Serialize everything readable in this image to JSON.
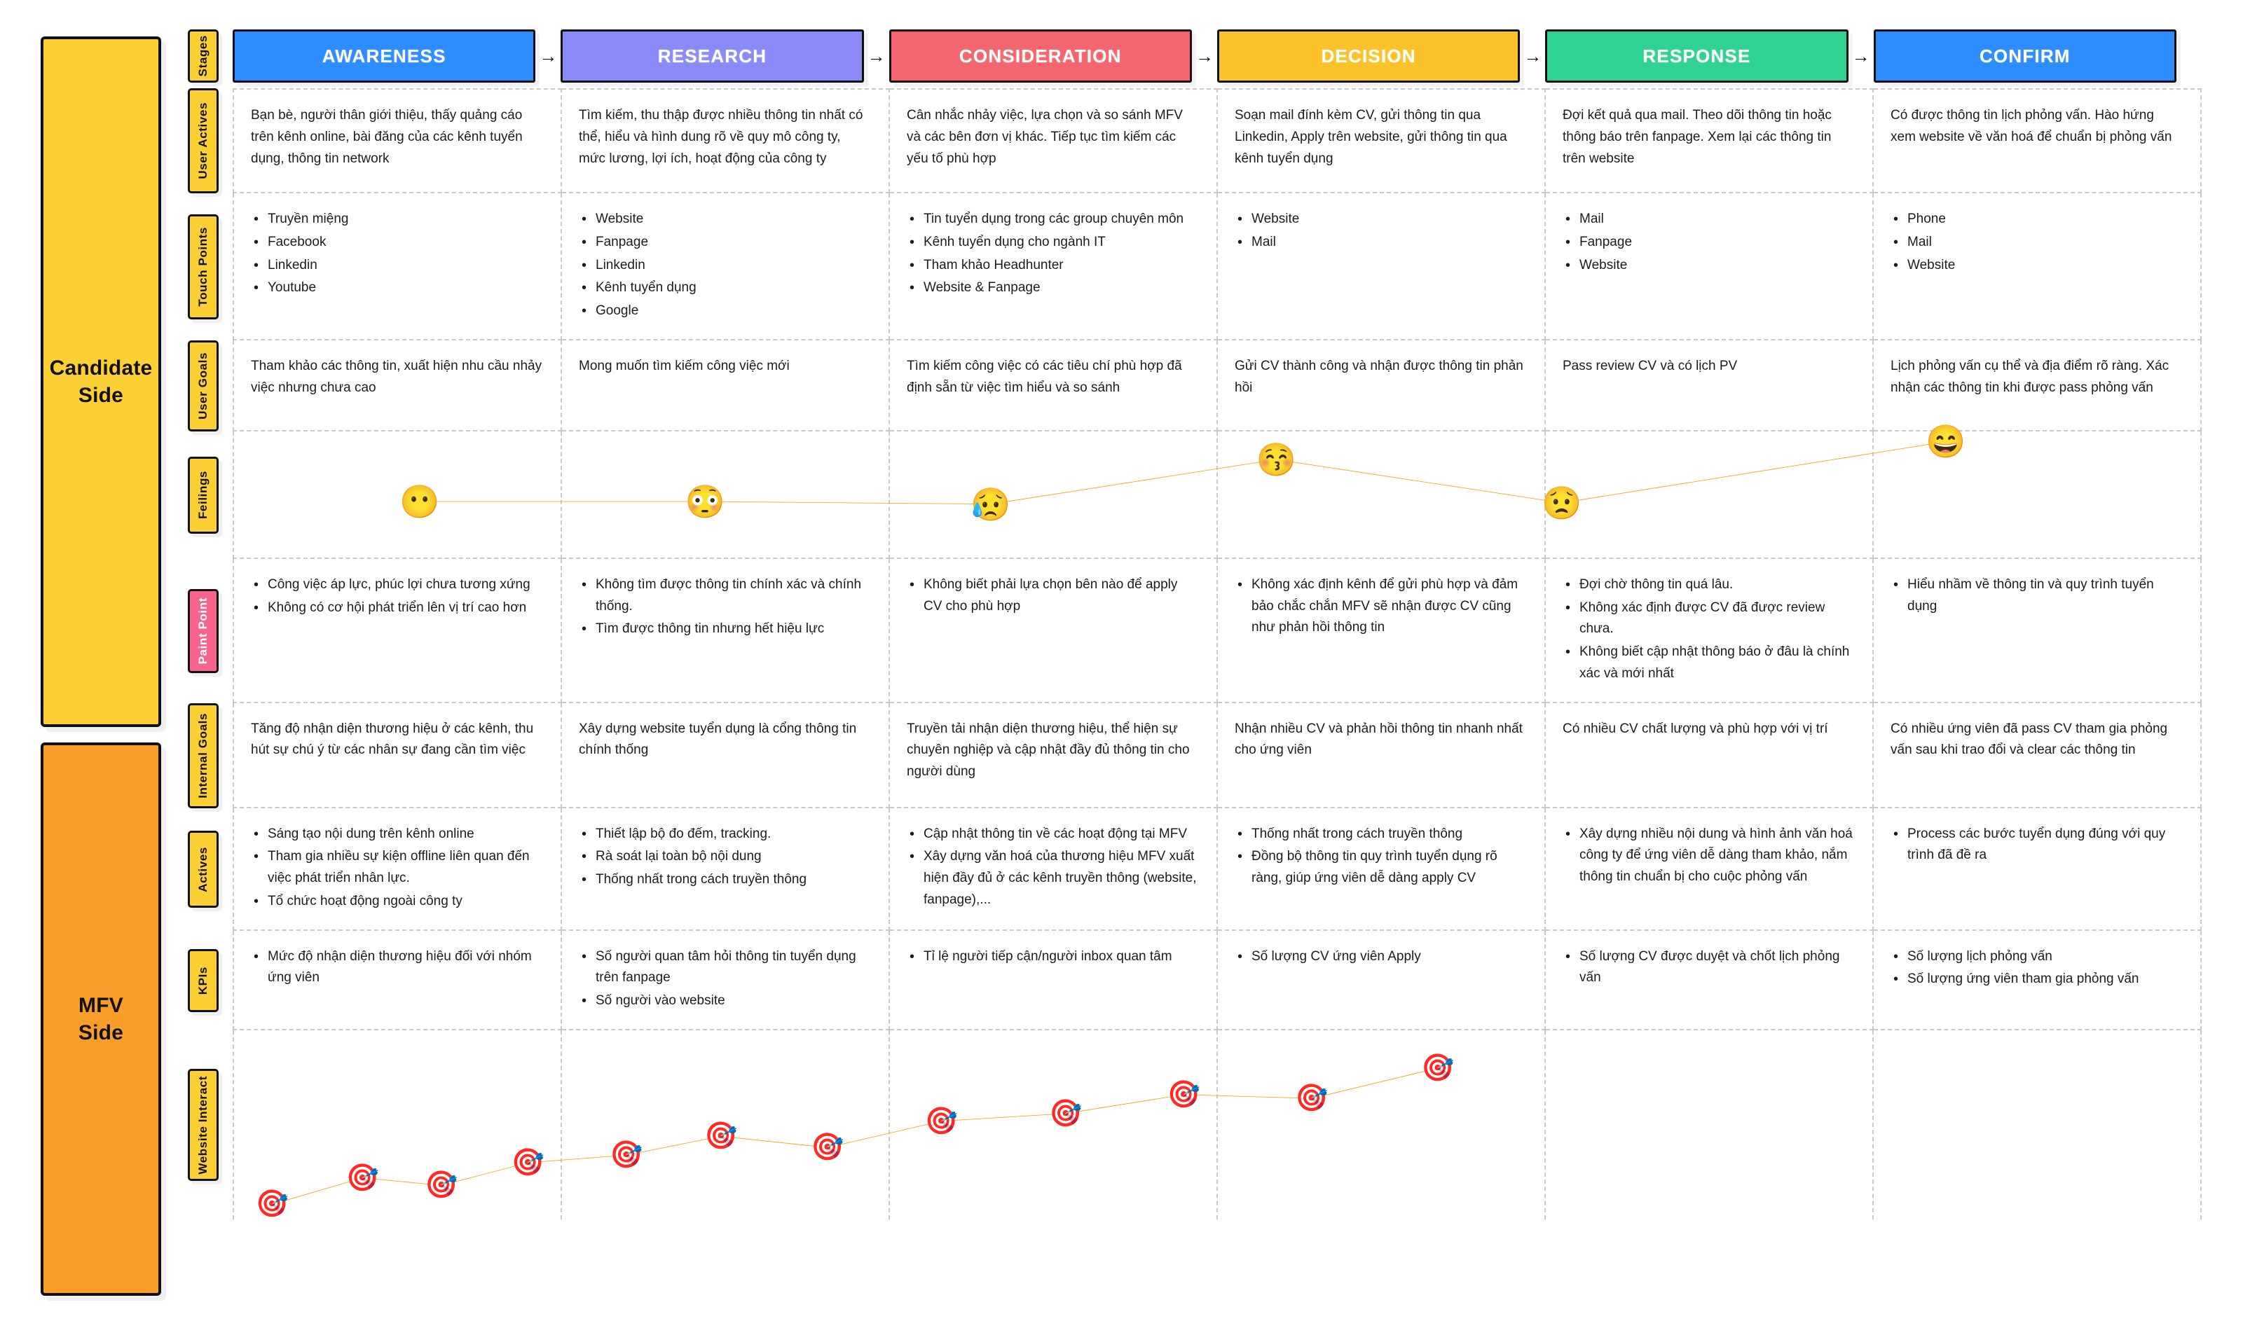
{
  "sides": [
    {
      "name": "candidate",
      "label": "Candidate\nSide",
      "color": "#fcd034"
    },
    {
      "name": "mfv",
      "label": "MFV\nSide",
      "color": "#f89c2a"
    }
  ],
  "row_labels": {
    "stages": "Stages",
    "user_actives": "User Actives",
    "touch_points": "Touch Points",
    "user_goals": "User Goals",
    "feelings": "Feilings",
    "pain_point": "Paint Point",
    "internal_goals": "Internal Goals",
    "actives": "Actives",
    "kpis": "KPIs",
    "website_interact": "Website Interact"
  },
  "arrow_glyph": "→",
  "stages": [
    {
      "label": "AWARENESS",
      "color": "#2d8cff"
    },
    {
      "label": "RESEARCH",
      "color": "#8b8bf7"
    },
    {
      "label": "CONSIDERATION",
      "color": "#f4666e"
    },
    {
      "label": "DECISION",
      "color": "#fcc22b"
    },
    {
      "label": "RESPONSE",
      "color": "#2fd291"
    },
    {
      "label": "CONFIRM",
      "color": "#2d8cff"
    }
  ],
  "user_actives": [
    "Bạn bè, người thân giới thiệu, thấy quảng cáo trên kênh online, bài đăng của các kênh tuyển dụng, thông tin network",
    "Tìm kiếm, thu thập được nhiều thông tin nhất có thể, hiểu và hình dung rõ về quy mô công ty, mức lương, lợi ích, hoạt động của công ty",
    "Cân nhắc nhảy việc, lựa chọn và so sánh MFV và các bên đơn vị khác. Tiếp tục tìm kiếm các yếu tố phù hợp",
    "Soạn mail đính kèm CV, gửi thông tin qua Linkedin, Apply trên website, gửi thông tin qua kênh tuyển dụng",
    "Đợi kết quả qua mail. Theo dõi thông tin hoặc thông báo trên fanpage. Xem lại các thông tin trên website",
    "Có được thông tin lịch phỏng vấn. Hào hứng xem website về văn hoá để chuẩn bị phỏng vấn"
  ],
  "touch_points": [
    [
      "Truyền miệng",
      "Facebook",
      "Linkedin",
      "Youtube"
    ],
    [
      "Website",
      "Fanpage",
      "Linkedin",
      "Kênh tuyển dụng",
      "Google"
    ],
    [
      "Tin tuyển dụng trong các group chuyên môn",
      "Kênh tuyển dụng cho ngành IT",
      "Tham khảo Headhunter",
      "Website & Fanpage"
    ],
    [
      "Website",
      "Mail"
    ],
    [
      "Mail",
      "Fanpage",
      "Website"
    ],
    [
      "Phone",
      "Mail",
      "Website"
    ]
  ],
  "user_goals": [
    "Tham khảo các thông tin, xuất hiện nhu cầu nhảy việc nhưng chưa cao",
    "Mong muốn tìm kiếm công việc mới",
    "Tìm kiếm công việc có các tiêu chí phù hợp đã định sẵn từ việc tìm hiểu và so sánh",
    "Gửi CV thành công và nhận được thông tin phản hồi",
    "Pass review CV và có lịch PV",
    "Lịch phỏng vấn cụ thể và địa điểm rõ ràng. Xác nhận các thông tin khi được pass phỏng vấn"
  ],
  "pain_point": [
    [
      "Công việc áp lực, phúc lợi chưa tương xứng",
      "Không có cơ hội phát triển lên vị trí cao hơn"
    ],
    [
      "Không tìm được thông tin chính xác và chính thống.",
      "Tìm được thông tin nhưng hết hiệu lực"
    ],
    [
      "Không biết phải lựa chọn bên nào để apply CV cho phù hợp"
    ],
    [
      "Không xác định kênh để gửi phù hợp và đảm bảo chắc chắn MFV sẽ nhận được CV cũng như phản hồi thông tin"
    ],
    [
      "Đợi chờ thông tin quá lâu.",
      "Không xác định được CV đã được review chưa.",
      "Không biết cập nhật thông báo ở đâu là chính xác và mới nhất"
    ],
    [
      "Hiểu nhầm về thông tin và quy trình tuyển dụng"
    ]
  ],
  "internal_goals": [
    "Tăng độ nhận diện thương hiệu ở các kênh, thu hút sự chú ý từ các nhân sự đang cần tìm việc",
    "Xây dựng website tuyển dụng là cổng thông tin chính thống",
    "Truyền tải nhận diện thương hiệu, thể hiện sự chuyên nghiệp và cập nhật đầy đủ thông tin cho người dùng",
    "Nhận nhiều CV và phản hồi thông tin nhanh nhất cho ứng viên",
    "Có nhiều CV chất lượng và phù hợp với vị trí",
    "Có nhiều ứng viên đã pass CV tham gia phỏng vấn sau khi trao đổi và clear các thông tin"
  ],
  "actives": [
    [
      "Sáng tạo nội dung trên kênh online",
      "Tham gia nhiều sự kiện offline liên quan đến việc phát triển nhân lực.",
      "Tổ chức hoạt động ngoài công ty"
    ],
    [
      "Thiết lập bộ đo đếm, tracking.",
      "Rà soát lại toàn bộ nội dung",
      "Thống nhất trong cách truyền thông"
    ],
    [
      "Cập nhật thông tin về các  hoạt động tại MFV",
      "Xây dựng văn hoá của thương hiệu MFV xuất hiện đầy đủ ở các kênh truyền thông (website, fanpage),..."
    ],
    [
      "Thống nhất trong cách truyền thông",
      "Đồng bộ thông tin quy trình tuyển dụng rõ ràng, giúp ứng viên dễ dàng apply CV"
    ],
    [
      "Xây dựng nhiều nội dung và hình ảnh văn hoá công ty để ứng viên dễ dàng tham khảo, nắm thông tin chuẩn bị cho cuộc phỏng vấn"
    ],
    [
      "Process các bước tuyển dụng đúng với quy trình đã đề ra"
    ]
  ],
  "kpis": [
    [
      "Mức độ nhận diện thương hiệu đối với nhóm ứng viên"
    ],
    [
      "Số người quan tâm hỏi thông tin tuyển dụng trên fanpage",
      "Số người vào website"
    ],
    [
      "Tỉ lệ người tiếp cận/người inbox quan tâm"
    ],
    [
      "Số lượng CV ứng viên Apply"
    ],
    [
      "Số lượng CV được duyệt và chốt lịch phỏng vấn"
    ],
    [
      "Số lượng lịch phỏng vấn",
      "Số lượng ứng viên tham gia phỏng vấn"
    ]
  ],
  "chart_data": [
    {
      "type": "line",
      "name": "feelings-line",
      "title": "Feilings",
      "categories": [
        "AWARENESS",
        "RESEARCH",
        "CONSIDERATION",
        "DECISION",
        "RESPONSE",
        "CONFIRM"
      ],
      "x": [
        9.5,
        24.0,
        38.5,
        53.0,
        67.5,
        87.0
      ],
      "values": [
        55,
        55,
        57,
        22,
        56,
        8
      ],
      "ylim": [
        0,
        100
      ],
      "line_color": "#f5a623",
      "grid": false,
      "legend": "none",
      "markers": [
        {
          "emoji": "😶",
          "label": "neutral-face"
        },
        {
          "emoji": "😳",
          "label": "flushed-face"
        },
        {
          "emoji": "😥",
          "label": "sad-but-relieved-face"
        },
        {
          "emoji": "😚",
          "label": "kissing-face"
        },
        {
          "emoji": "😟",
          "label": "worried-face"
        },
        {
          "emoji": "😄",
          "label": "grinning-face"
        }
      ]
    },
    {
      "type": "line",
      "name": "website-interact-line",
      "title": "Website Interact",
      "x": [
        2.0,
        6.6,
        10.6,
        15.0,
        20.0,
        24.8,
        30.2,
        36.0,
        42.3,
        48.3,
        54.8,
        61.2
      ],
      "values": [
        92,
        78,
        82,
        70,
        66,
        56,
        62,
        48,
        44,
        34,
        36,
        20
      ],
      "ylim": [
        0,
        100
      ],
      "line_color": "#f5a623",
      "grid": false,
      "legend": "none",
      "marker_emoji": "🎯",
      "marker_label": "dart-target"
    }
  ]
}
